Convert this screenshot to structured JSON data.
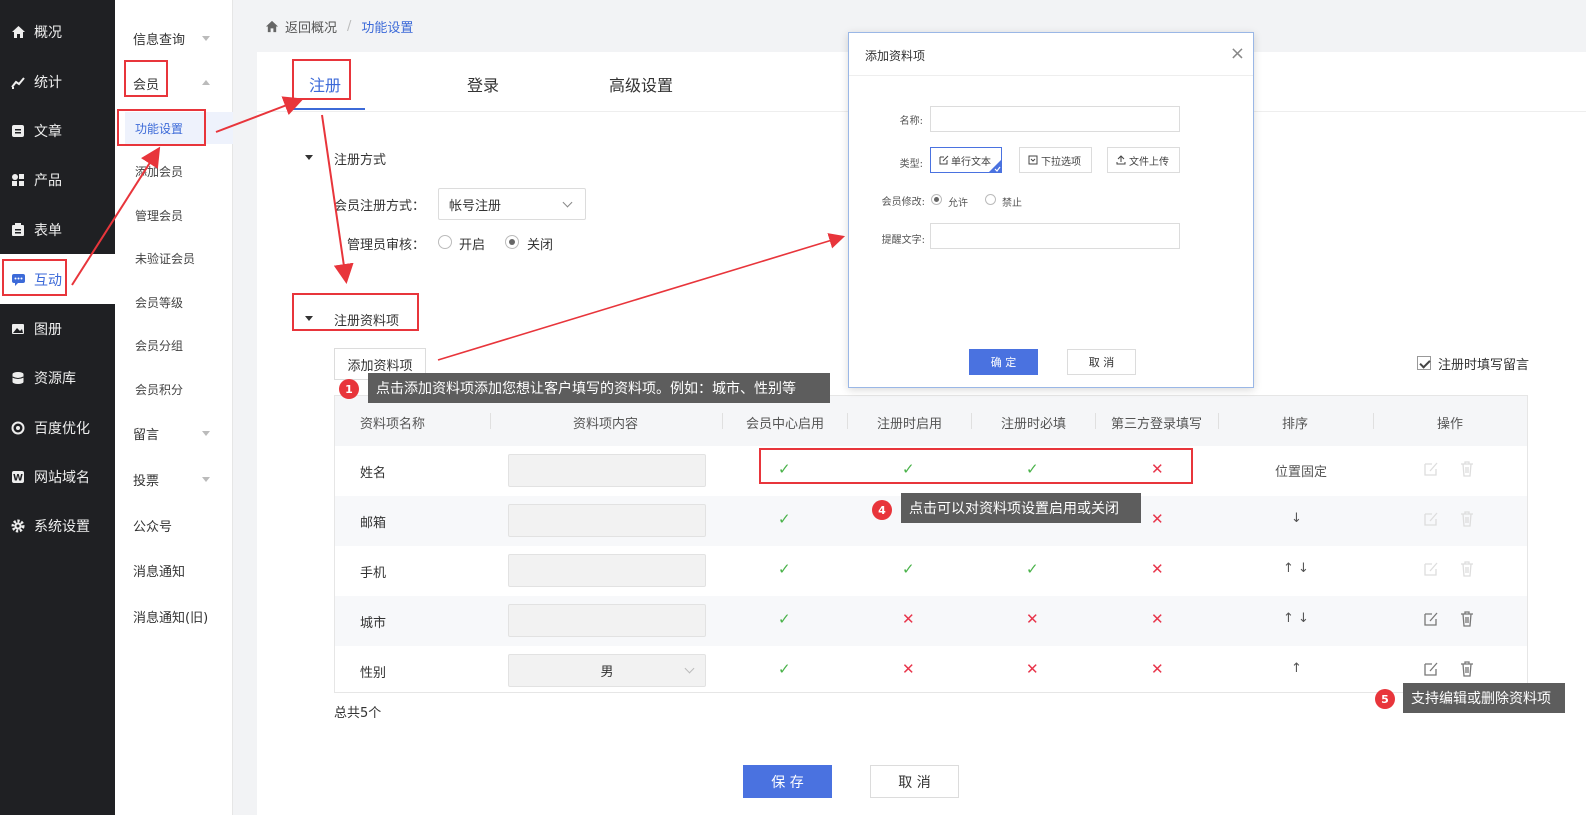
{
  "nav": {
    "items": [
      {
        "label": "概况",
        "icon": "home-icon"
      },
      {
        "label": "统计",
        "icon": "stats-icon"
      },
      {
        "label": "文章",
        "icon": "article-icon"
      },
      {
        "label": "产品",
        "icon": "product-icon"
      },
      {
        "label": "表单",
        "icon": "form-icon"
      },
      {
        "label": "互动",
        "icon": "chat-icon"
      },
      {
        "label": "图册",
        "icon": "album-icon"
      },
      {
        "label": "资源库",
        "icon": "database-icon"
      },
      {
        "label": "百度优化",
        "icon": "seo-icon"
      },
      {
        "label": "网站域名",
        "icon": "domain-icon"
      },
      {
        "label": "系统设置",
        "icon": "gear-icon"
      }
    ]
  },
  "sub": {
    "info_query": "信息查询",
    "member": "会员",
    "feature_settings": "功能设置",
    "add_member": "添加会员",
    "manage_member": "管理会员",
    "unverified": "未验证会员",
    "member_level": "会员等级",
    "member_group": "会员分组",
    "member_points": "会员积分",
    "message": "留言",
    "vote": "投票",
    "public_account": "公众号",
    "notice": "消息通知",
    "notice_old": "消息通知(旧)"
  },
  "breadcrumb": {
    "back": "返回概况",
    "sep": "/",
    "current": "功能设置"
  },
  "tabs": [
    "注册",
    "登录",
    "高级设置"
  ],
  "reg_method": {
    "section": "注册方式",
    "method_label": "会员注册方式：",
    "method_value": "帐号注册",
    "review_label": "管理员审核：",
    "on": "开启",
    "off": "关闭"
  },
  "reg_fields": {
    "section": "注册资料项",
    "add_button": "添加资料项",
    "leave_message": "注册时填写留言",
    "total": "总共5个"
  },
  "table": {
    "headers": [
      "资料项名称",
      "资料项内容",
      "会员中心启用",
      "注册时启用",
      "注册时必填",
      "第三方登录填写",
      "排序",
      "操作"
    ],
    "rows": [
      {
        "name": "姓名",
        "content": "",
        "center": "✓",
        "reg": "✓",
        "required": "✓",
        "third": "✕",
        "sort": "位置固定"
      },
      {
        "name": "邮箱",
        "content": "",
        "center": "✓",
        "reg": "",
        "required": "",
        "third": "✕",
        "sort": "↓"
      },
      {
        "name": "手机",
        "content": "",
        "center": "✓",
        "reg": "✓",
        "required": "✓",
        "third": "✕",
        "sort": "↑ ↓"
      },
      {
        "name": "城市",
        "content": "",
        "center": "✓",
        "reg": "✕",
        "required": "✕",
        "third": "✕",
        "sort": "↑ ↓"
      },
      {
        "name": "性别",
        "content": "男",
        "center": "✓",
        "reg": "✕",
        "required": "✕",
        "third": "✕",
        "sort": "↑"
      }
    ]
  },
  "annotations": {
    "a1_num": "1",
    "a1_text": "点击添加资料项添加您想让客户填写的资料项。例如：城市、性别等",
    "a4_num": "4",
    "a4_text": "点击可以对资料项设置启用或关闭",
    "a5_num": "5",
    "a5_text": "支持编辑或删除资料项"
  },
  "modal": {
    "title": "添加资料项",
    "close": "×",
    "name_label": "名称:",
    "type_label": "类型:",
    "type_options": [
      "单行文本",
      "下拉选项",
      "文件上传"
    ],
    "modify_label": "会员修改:",
    "allow": "允许",
    "forbid": "禁止",
    "hint_label": "提醒文字:",
    "confirm": "确 定",
    "cancel": "取 消"
  },
  "footer": {
    "save": "保 存",
    "cancel": "取 消"
  },
  "colors": {
    "accent": "#3c6ad8",
    "nav_bg": "#1f2023",
    "annotation_red": "#e8353b",
    "check": "#4bb34b",
    "cross": "#e8354b"
  }
}
